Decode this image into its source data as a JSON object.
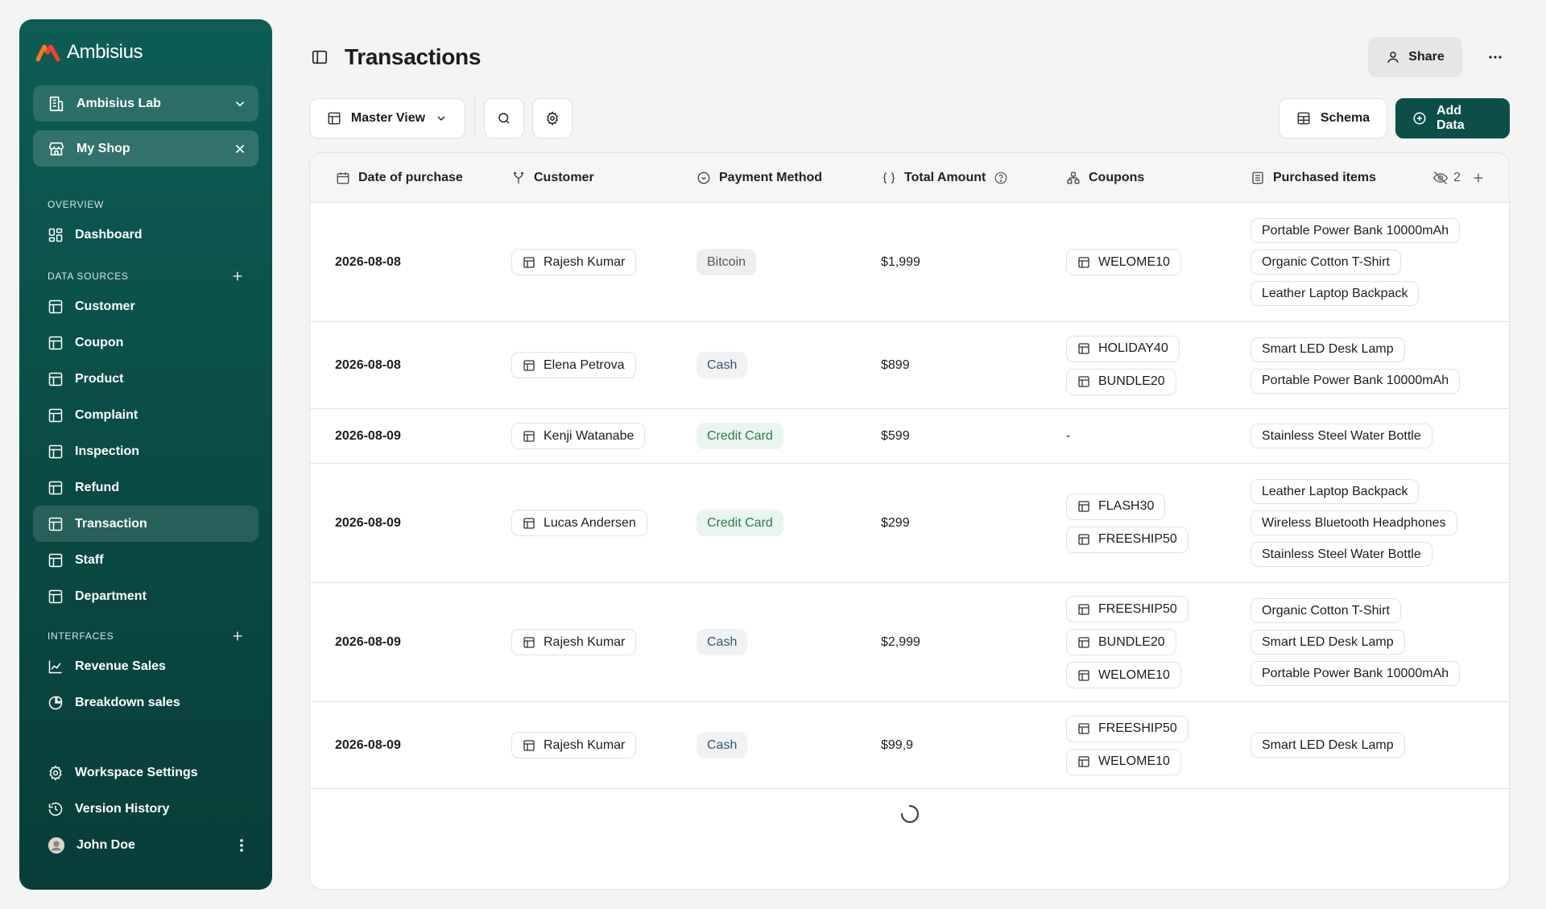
{
  "brand": {
    "name": "Ambisius"
  },
  "sidebar": {
    "workspace": "Ambisius Lab",
    "shop": "My Shop",
    "overview_title": "OVERVIEW",
    "overview_items": [
      {
        "label": "Dashboard",
        "icon": "dashboard-icon"
      }
    ],
    "data_sources_title": "DATA SOURCES",
    "data_sources": [
      {
        "label": "Customer"
      },
      {
        "label": "Coupon"
      },
      {
        "label": "Product"
      },
      {
        "label": "Complaint"
      },
      {
        "label": "Inspection"
      },
      {
        "label": "Refund"
      },
      {
        "label": "Transaction",
        "active": true
      },
      {
        "label": "Staff"
      },
      {
        "label": "Department"
      }
    ],
    "interfaces_title": "INTERFACES",
    "interfaces": [
      {
        "label": "Revenue Sales",
        "icon": "line-chart-icon"
      },
      {
        "label": "Breakdown sales",
        "icon": "pie-chart-icon"
      }
    ],
    "settings_label": "Workspace Settings",
    "history_label": "Version History",
    "user_name": "John Doe"
  },
  "header": {
    "title": "Transactions",
    "share_label": "Share"
  },
  "toolbar": {
    "view_label": "Master View",
    "schema_label": "Schema",
    "add_label": "Add Data"
  },
  "table": {
    "columns": {
      "date": "Date of purchase",
      "customer": "Customer",
      "payment": "Payment Method",
      "amount": "Total Amount",
      "coupons": "Coupons",
      "items": "Purchased items"
    },
    "hidden_count": "2",
    "rows": [
      {
        "date": "2026-08-08",
        "customer": "Rajesh Kumar",
        "payment": "Bitcoin",
        "amount": "$1,999",
        "coupons": [
          "WELOME10"
        ],
        "items": [
          "Portable Power Bank 10000mAh",
          "Organic Cotton T-Shirt",
          "Leather Laptop Backpack"
        ]
      },
      {
        "date": "2026-08-08",
        "customer": "Elena Petrova",
        "payment": "Cash",
        "amount": "$899",
        "coupons": [
          "HOLIDAY40",
          "BUNDLE20"
        ],
        "items": [
          "Smart LED Desk Lamp",
          "Portable Power Bank 10000mAh"
        ]
      },
      {
        "date": "2026-08-09",
        "customer": "Kenji Watanabe",
        "payment": "Credit Card",
        "amount": "$599",
        "coupons": [],
        "coupon_empty": "-",
        "items": [
          "Stainless Steel Water Bottle"
        ]
      },
      {
        "date": "2026-08-09",
        "customer": "Lucas Andersen",
        "payment": "Credit Card",
        "amount": "$299",
        "coupons": [
          "FLASH30",
          "FREESHIP50"
        ],
        "items": [
          "Leather Laptop Backpack",
          "Wireless Bluetooth Headphones",
          "Stainless Steel Water Bottle"
        ]
      },
      {
        "date": "2026-08-09",
        "customer": "Rajesh Kumar",
        "payment": "Cash",
        "amount": "$2,999",
        "coupons": [
          "FREESHIP50",
          "BUNDLE20",
          "WELOME10"
        ],
        "items": [
          "Organic Cotton T-Shirt",
          "Smart LED Desk Lamp",
          "Portable Power Bank 10000mAh"
        ]
      },
      {
        "date": "2026-08-09",
        "customer": "Rajesh Kumar",
        "payment": "Cash",
        "amount": "$99,9",
        "coupons": [
          "FREESHIP50",
          "WELOME10"
        ],
        "items": [
          "Smart LED Desk Lamp"
        ]
      }
    ]
  },
  "colors": {
    "brand_teal": "#0c4f49",
    "sidebar_top": "#0d5d55",
    "credit_green": "#2f7a4a",
    "cash_blue": "#3a5675"
  }
}
